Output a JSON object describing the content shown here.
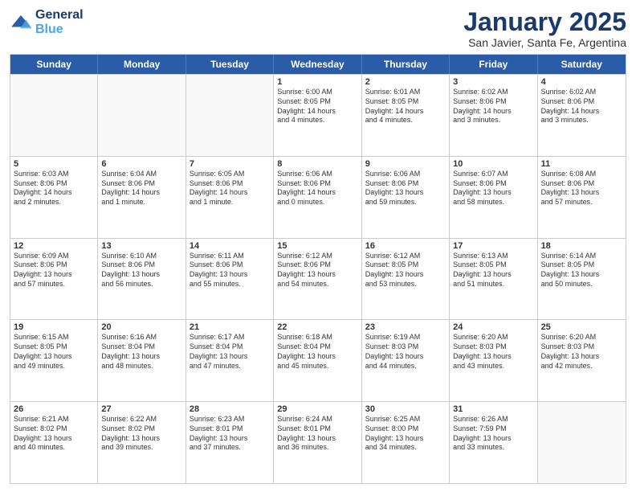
{
  "header": {
    "logo_line1": "General",
    "logo_line2": "Blue",
    "title": "January 2025",
    "location": "San Javier, Santa Fe, Argentina"
  },
  "days_of_week": [
    "Sunday",
    "Monday",
    "Tuesday",
    "Wednesday",
    "Thursday",
    "Friday",
    "Saturday"
  ],
  "weeks": [
    [
      {
        "day": "",
        "text": ""
      },
      {
        "day": "",
        "text": ""
      },
      {
        "day": "",
        "text": ""
      },
      {
        "day": "1",
        "text": "Sunrise: 6:00 AM\nSunset: 8:05 PM\nDaylight: 14 hours\nand 4 minutes."
      },
      {
        "day": "2",
        "text": "Sunrise: 6:01 AM\nSunset: 8:05 PM\nDaylight: 14 hours\nand 4 minutes."
      },
      {
        "day": "3",
        "text": "Sunrise: 6:02 AM\nSunset: 8:06 PM\nDaylight: 14 hours\nand 3 minutes."
      },
      {
        "day": "4",
        "text": "Sunrise: 6:02 AM\nSunset: 8:06 PM\nDaylight: 14 hours\nand 3 minutes."
      }
    ],
    [
      {
        "day": "5",
        "text": "Sunrise: 6:03 AM\nSunset: 8:06 PM\nDaylight: 14 hours\nand 2 minutes."
      },
      {
        "day": "6",
        "text": "Sunrise: 6:04 AM\nSunset: 8:06 PM\nDaylight: 14 hours\nand 1 minute."
      },
      {
        "day": "7",
        "text": "Sunrise: 6:05 AM\nSunset: 8:06 PM\nDaylight: 14 hours\nand 1 minute."
      },
      {
        "day": "8",
        "text": "Sunrise: 6:06 AM\nSunset: 8:06 PM\nDaylight: 14 hours\nand 0 minutes."
      },
      {
        "day": "9",
        "text": "Sunrise: 6:06 AM\nSunset: 8:06 PM\nDaylight: 13 hours\nand 59 minutes."
      },
      {
        "day": "10",
        "text": "Sunrise: 6:07 AM\nSunset: 8:06 PM\nDaylight: 13 hours\nand 58 minutes."
      },
      {
        "day": "11",
        "text": "Sunrise: 6:08 AM\nSunset: 8:06 PM\nDaylight: 13 hours\nand 57 minutes."
      }
    ],
    [
      {
        "day": "12",
        "text": "Sunrise: 6:09 AM\nSunset: 8:06 PM\nDaylight: 13 hours\nand 57 minutes."
      },
      {
        "day": "13",
        "text": "Sunrise: 6:10 AM\nSunset: 8:06 PM\nDaylight: 13 hours\nand 56 minutes."
      },
      {
        "day": "14",
        "text": "Sunrise: 6:11 AM\nSunset: 8:06 PM\nDaylight: 13 hours\nand 55 minutes."
      },
      {
        "day": "15",
        "text": "Sunrise: 6:12 AM\nSunset: 8:06 PM\nDaylight: 13 hours\nand 54 minutes."
      },
      {
        "day": "16",
        "text": "Sunrise: 6:12 AM\nSunset: 8:05 PM\nDaylight: 13 hours\nand 53 minutes."
      },
      {
        "day": "17",
        "text": "Sunrise: 6:13 AM\nSunset: 8:05 PM\nDaylight: 13 hours\nand 51 minutes."
      },
      {
        "day": "18",
        "text": "Sunrise: 6:14 AM\nSunset: 8:05 PM\nDaylight: 13 hours\nand 50 minutes."
      }
    ],
    [
      {
        "day": "19",
        "text": "Sunrise: 6:15 AM\nSunset: 8:05 PM\nDaylight: 13 hours\nand 49 minutes."
      },
      {
        "day": "20",
        "text": "Sunrise: 6:16 AM\nSunset: 8:04 PM\nDaylight: 13 hours\nand 48 minutes."
      },
      {
        "day": "21",
        "text": "Sunrise: 6:17 AM\nSunset: 8:04 PM\nDaylight: 13 hours\nand 47 minutes."
      },
      {
        "day": "22",
        "text": "Sunrise: 6:18 AM\nSunset: 8:04 PM\nDaylight: 13 hours\nand 45 minutes."
      },
      {
        "day": "23",
        "text": "Sunrise: 6:19 AM\nSunset: 8:03 PM\nDaylight: 13 hours\nand 44 minutes."
      },
      {
        "day": "24",
        "text": "Sunrise: 6:20 AM\nSunset: 8:03 PM\nDaylight: 13 hours\nand 43 minutes."
      },
      {
        "day": "25",
        "text": "Sunrise: 6:20 AM\nSunset: 8:03 PM\nDaylight: 13 hours\nand 42 minutes."
      }
    ],
    [
      {
        "day": "26",
        "text": "Sunrise: 6:21 AM\nSunset: 8:02 PM\nDaylight: 13 hours\nand 40 minutes."
      },
      {
        "day": "27",
        "text": "Sunrise: 6:22 AM\nSunset: 8:02 PM\nDaylight: 13 hours\nand 39 minutes."
      },
      {
        "day": "28",
        "text": "Sunrise: 6:23 AM\nSunset: 8:01 PM\nDaylight: 13 hours\nand 37 minutes."
      },
      {
        "day": "29",
        "text": "Sunrise: 6:24 AM\nSunset: 8:01 PM\nDaylight: 13 hours\nand 36 minutes."
      },
      {
        "day": "30",
        "text": "Sunrise: 6:25 AM\nSunset: 8:00 PM\nDaylight: 13 hours\nand 34 minutes."
      },
      {
        "day": "31",
        "text": "Sunrise: 6:26 AM\nSunset: 7:59 PM\nDaylight: 13 hours\nand 33 minutes."
      },
      {
        "day": "",
        "text": ""
      }
    ]
  ]
}
